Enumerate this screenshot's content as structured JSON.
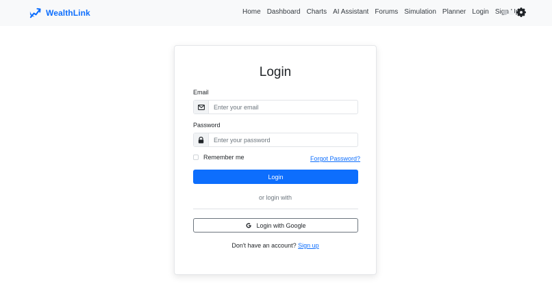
{
  "navbar": {
    "brand": "WealthLink",
    "brand_icon": "chart-up-icon",
    "links": [
      "Home",
      "Dashboard",
      "Charts",
      "AI Assistant",
      "Forums",
      "Simulation",
      "Planner",
      "Login",
      "Sign Up"
    ],
    "theme_icon": "gear-icon",
    "accent": "#0d6efd"
  },
  "form": {
    "title": "Login",
    "email_label": "Email",
    "email_placeholder": "Enter your email",
    "email_icon": "envelope-icon",
    "password_label": "Password",
    "password_placeholder": "Enter your password",
    "password_icon": "lock-icon",
    "remember_label": "Remember me",
    "forgot_label": "Forgot Password?",
    "login_button": "Login",
    "or_text": "or login with",
    "google_button": "Login with Google",
    "google_icon": "google-g-icon",
    "signup_prompt": "Don't have an account?",
    "signup_link": "Sign up"
  }
}
